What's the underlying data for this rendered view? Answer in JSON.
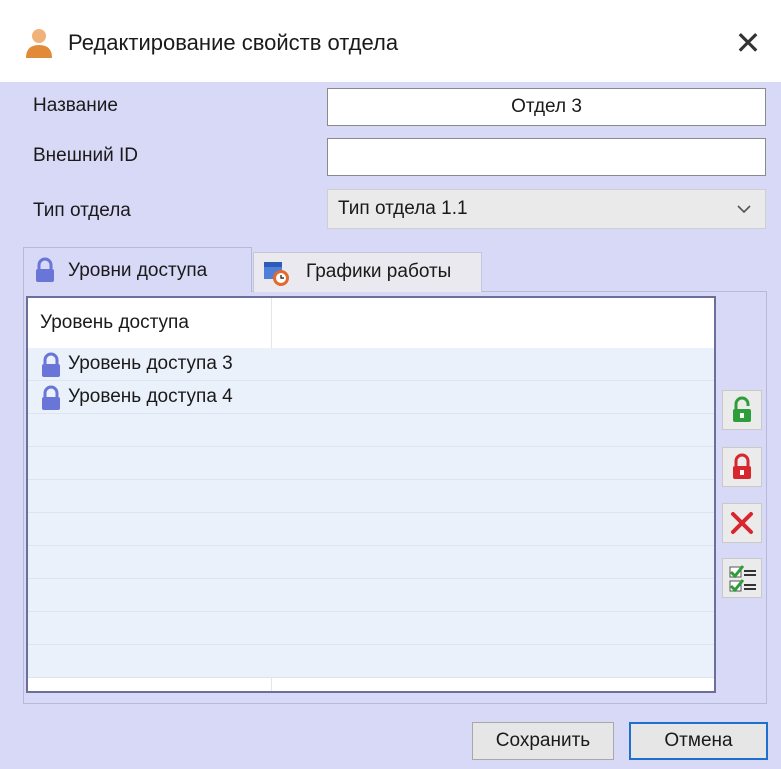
{
  "window": {
    "title": "Редактирование свойств отдела",
    "title_icon": "user-icon",
    "close_glyph": "✕"
  },
  "form": {
    "name_label": "Название",
    "name_value": "Отдел 3",
    "external_id_label": "Внешний ID",
    "external_id_value": "",
    "type_label": "Тип отдела",
    "type_value": "Тип отдела 1.1"
  },
  "tabs": [
    {
      "label": "Уровни доступа",
      "icon": "lock-icon",
      "active": true
    },
    {
      "label": "Графики работы",
      "icon": "schedule-icon",
      "active": false
    }
  ],
  "table": {
    "column_header": "Уровень доступа",
    "rows": [
      {
        "label": "Уровень доступа 3",
        "icon": "lock-icon"
      },
      {
        "label": "Уровень доступа 4",
        "icon": "lock-icon"
      }
    ],
    "empty_rows": 8
  },
  "side_buttons": [
    {
      "icon": "green-lock-icon",
      "color": "#2e9e3a"
    },
    {
      "icon": "red-lock-icon",
      "color": "#d7262e"
    },
    {
      "icon": "delete-icon",
      "color": "#d7262e"
    },
    {
      "icon": "checklist-icon",
      "color": "#2e9e3a"
    }
  ],
  "footer": {
    "save_label": "Сохранить",
    "cancel_label": "Отмена"
  },
  "colors": {
    "window_bg": "#d7d9f7",
    "row_bg": "#eaf1fa",
    "accent": "#1f6fd1"
  }
}
